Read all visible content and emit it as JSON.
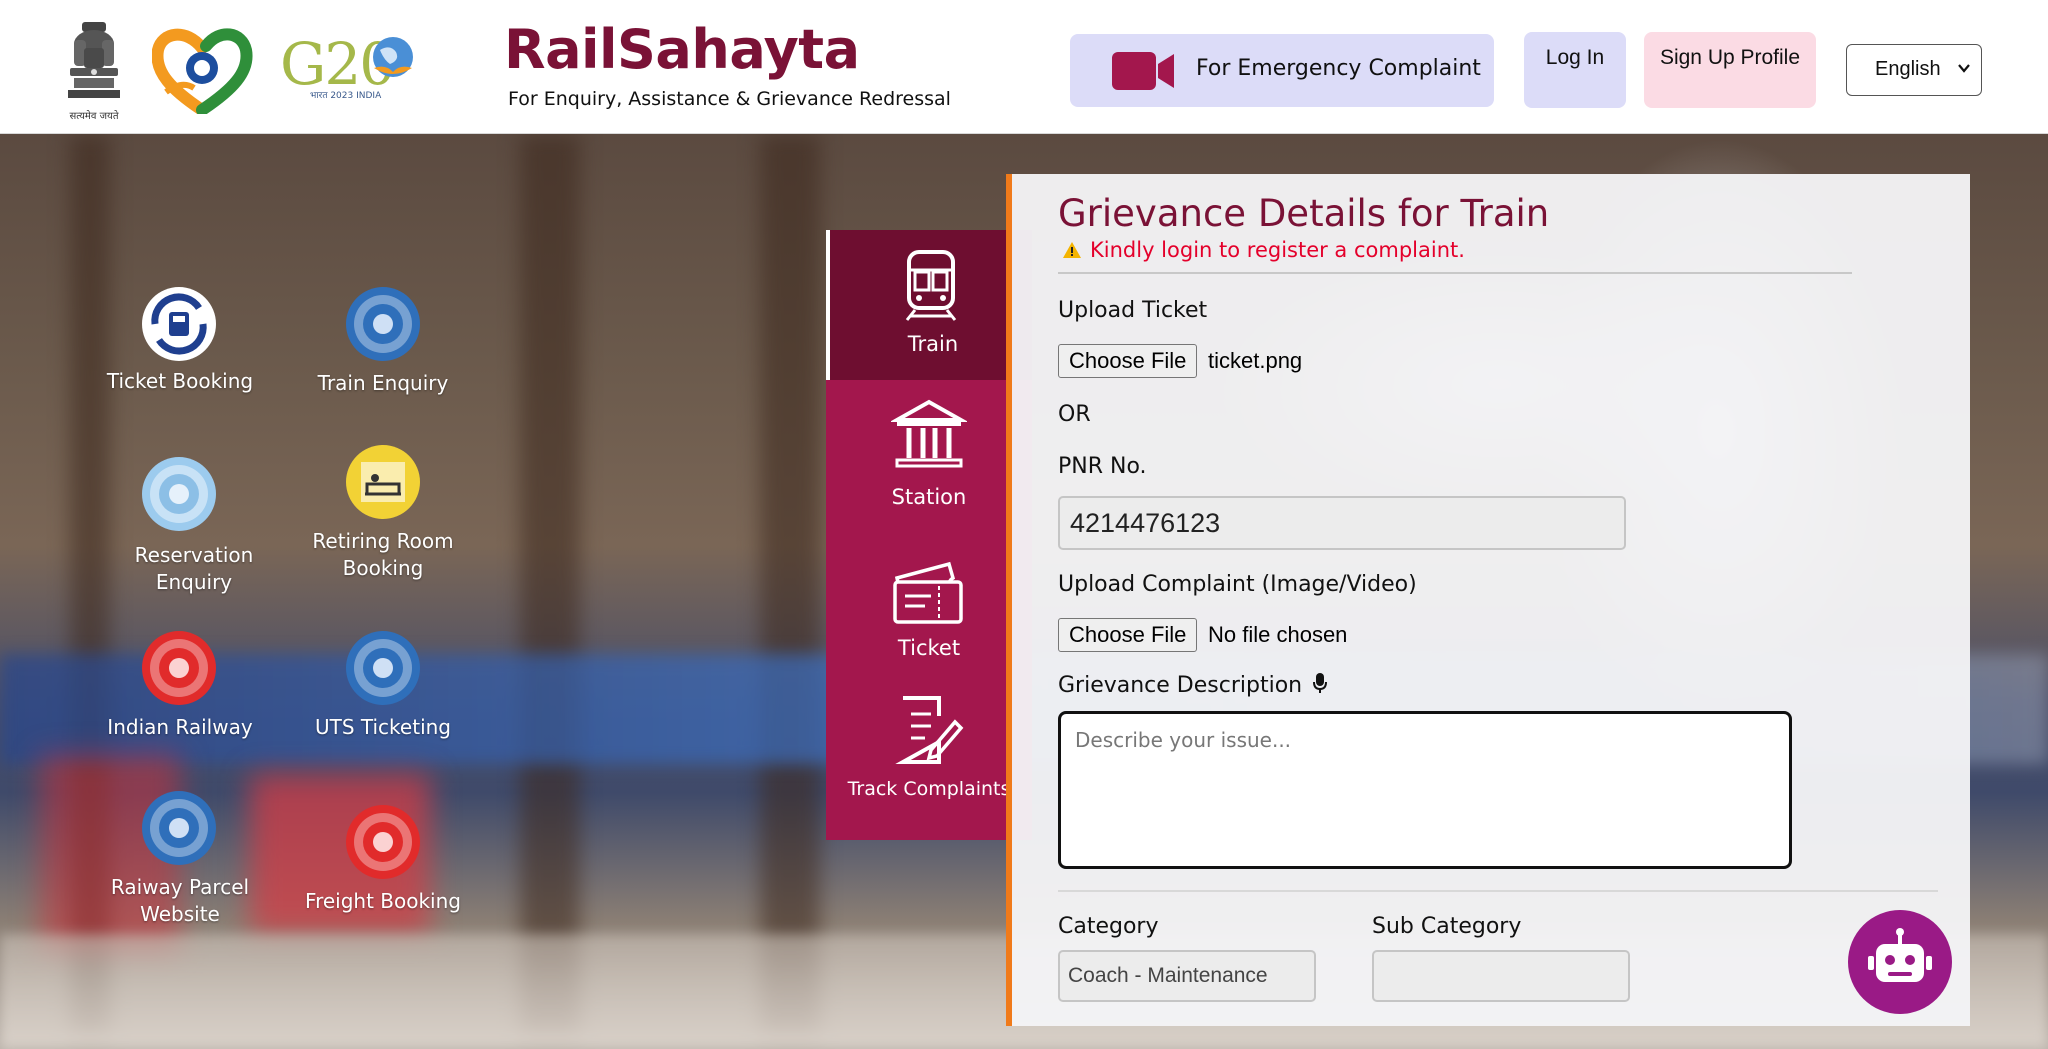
{
  "header": {
    "emblem_caption": "सत्यमेव जयते",
    "g20_text": "G20",
    "g20_sub": "भारत 2023 INDIA",
    "brand_title": "RailSahayta",
    "brand_subtitle": "For Enquiry, Assistance & Grievance Redressal",
    "emergency_label": "For Emergency Complaint",
    "login_label": "Log In",
    "signup_label": "Sign Up Profile",
    "language": "English"
  },
  "quick_links": [
    {
      "label": "Ticket Booking",
      "icon": "irctc-logo-icon"
    },
    {
      "label": "Train Enquiry",
      "icon": "indian-railways-logo-icon"
    },
    {
      "label": "Reservation Enquiry",
      "icon": "indian-railways-logo-icon"
    },
    {
      "label": "Retiring Room Booking",
      "icon": "retiring-room-icon"
    },
    {
      "label": "Indian Railway",
      "icon": "indian-railways-red-logo-icon"
    },
    {
      "label": "UTS Ticketing",
      "icon": "indian-railways-logo-icon"
    },
    {
      "label": "Raiway Parcel Website",
      "icon": "indian-railways-logo-icon"
    },
    {
      "label": "Freight Booking",
      "icon": "indian-railways-red-logo-icon"
    }
  ],
  "tabs": [
    {
      "label": "Train",
      "icon": "train-icon",
      "active": true
    },
    {
      "label": "Station",
      "icon": "station-building-icon",
      "active": false
    },
    {
      "label": "Ticket",
      "icon": "ticket-icon",
      "active": false
    },
    {
      "label": "Track Complaints",
      "icon": "document-edit-icon",
      "active": false
    }
  ],
  "form": {
    "title": "Grievance Details for Train",
    "warning": "Kindly login to register a complaint.",
    "upload_ticket_label": "Upload Ticket",
    "choose_file_label": "Choose File",
    "ticket_file_name": "ticket.png",
    "or_label": "OR",
    "pnr_label": "PNR No.",
    "pnr_value": "4214476123",
    "upload_complaint_label": "Upload Complaint (Image/Video)",
    "complaint_file_name": "No file chosen",
    "description_label": "Grievance Description",
    "description_placeholder": "Describe your issue...",
    "category_label": "Category",
    "category_value": "Coach - Maintenance",
    "subcategory_label": "Sub Category",
    "subcategory_value": ""
  },
  "colors": {
    "brand": "#7a1236",
    "tab_bg": "#a3174d",
    "tab_active": "#6e0e30",
    "panel_border": "#f07a1a",
    "warning": "#e4002b",
    "chatbot": "#9a1a86"
  }
}
